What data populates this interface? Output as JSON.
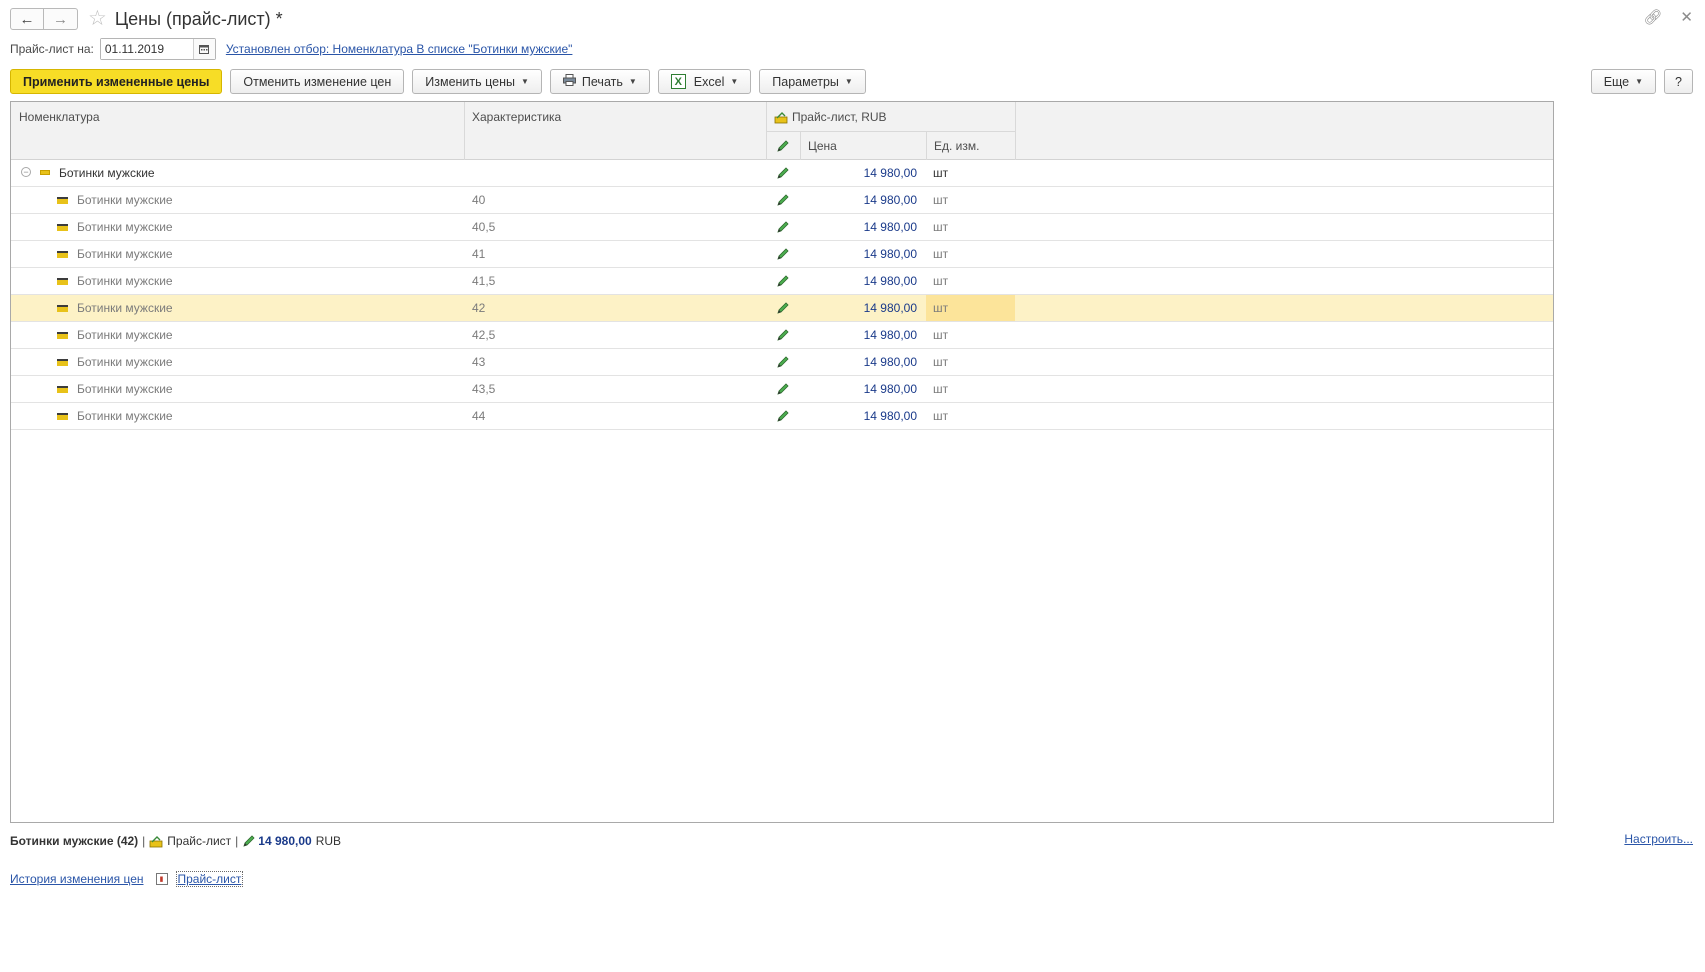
{
  "window": {
    "title": "Цены (прайс-лист) *"
  },
  "filter": {
    "date_label": "Прайс-лист на:",
    "date_value": "01.11.2019",
    "filter_link": "Установлен отбор: Номенклатура В списке \"Ботинки мужские\""
  },
  "toolbar": {
    "apply_label": "Применить измененные цены",
    "cancel_label": "Отменить изменение цен",
    "change_prices_label": "Изменить цены",
    "print_label": "Печать",
    "excel_label": "Excel",
    "params_label": "Параметры",
    "more_label": "Еще",
    "help_label": "?"
  },
  "columns": {
    "name": "Номенклатура",
    "characteristic": "Характеристика",
    "pricelist_group": "Прайс-лист, RUB",
    "price": "Цена",
    "unit": "Ед. изм."
  },
  "group_row": {
    "name": "Ботинки мужские",
    "price": "14 980,00",
    "unit": "шт"
  },
  "rows": [
    {
      "name": "Ботинки мужские",
      "characteristic": "40",
      "price": "14 980,00",
      "unit": "шт"
    },
    {
      "name": "Ботинки мужские",
      "characteristic": "40,5",
      "price": "14 980,00",
      "unit": "шт"
    },
    {
      "name": "Ботинки мужские",
      "characteristic": "41",
      "price": "14 980,00",
      "unit": "шт"
    },
    {
      "name": "Ботинки мужские",
      "characteristic": "41,5",
      "price": "14 980,00",
      "unit": "шт"
    },
    {
      "name": "Ботинки мужские",
      "characteristic": "42",
      "price": "14 980,00",
      "unit": "шт"
    },
    {
      "name": "Ботинки мужские",
      "characteristic": "42,5",
      "price": "14 980,00",
      "unit": "шт"
    },
    {
      "name": "Ботинки мужские",
      "characteristic": "43",
      "price": "14 980,00",
      "unit": "шт"
    },
    {
      "name": "Ботинки мужские",
      "characteristic": "43,5",
      "price": "14 980,00",
      "unit": "шт"
    },
    {
      "name": "Ботинки мужские",
      "characteristic": "44",
      "price": "14 980,00",
      "unit": "шт"
    }
  ],
  "selected_row_index": 4,
  "status": {
    "item": "Ботинки мужские (42)",
    "separator": "|",
    "pricelist": "Прайс-лист",
    "price": "14 980,00",
    "currency": "RUB",
    "configure_link": "Настроить..."
  },
  "bottom_links": {
    "history": "История изменения цен",
    "pricelist": "Прайс-лист"
  },
  "colors": {
    "primary_button": "#f7dd26",
    "selected_row": "#fdf2c6",
    "price_text": "#1a3a8a",
    "link": "#2a55a8"
  },
  "icons": [
    "back-arrow-icon",
    "forward-arrow-icon",
    "favorite-star-icon",
    "link-icon",
    "close-icon",
    "calendar-icon",
    "printer-icon",
    "excel-icon",
    "pencil-icon",
    "product-icon",
    "folder-icon",
    "pricelist-icon",
    "report-icon"
  ]
}
